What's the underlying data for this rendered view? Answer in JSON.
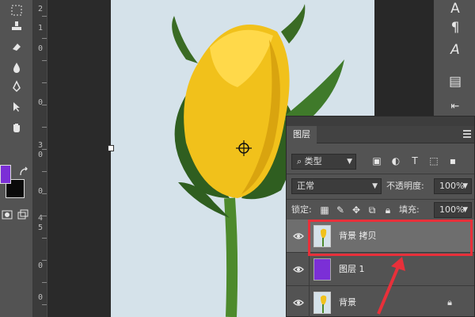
{
  "toolbar": {
    "tools": [
      "marquee-icon",
      "stamp-icon",
      "eraser-icon",
      "drop-icon",
      "pen-icon",
      "select-arrow-icon",
      "hand-icon"
    ],
    "foreground_color": "#7b2fd6",
    "background_color": "#0a0a0a"
  },
  "ruler": {
    "labels": [
      "2",
      "1",
      "0",
      "0",
      "3",
      "0",
      "0",
      "4",
      "5",
      "0",
      "0"
    ]
  },
  "dock": {
    "icons": [
      "A",
      "¶",
      "A",
      "▤",
      "⇤",
      "≡"
    ]
  },
  "layers_panel": {
    "tab_label": "图层",
    "filter_label": "类型",
    "blend_mode": "正常",
    "opacity_label": "不透明度:",
    "opacity_value": "100%",
    "lock_label": "锁定:",
    "fill_label": "填充:",
    "fill_value": "100%",
    "layers": [
      {
        "name": "背景 拷贝",
        "selected": true
      },
      {
        "name": "图层 1",
        "selected": false
      },
      {
        "name": "背景",
        "selected": false,
        "locked": true
      }
    ]
  },
  "colors": {
    "highlight": "#e8303a",
    "accent_purple": "#7b2fd6"
  }
}
